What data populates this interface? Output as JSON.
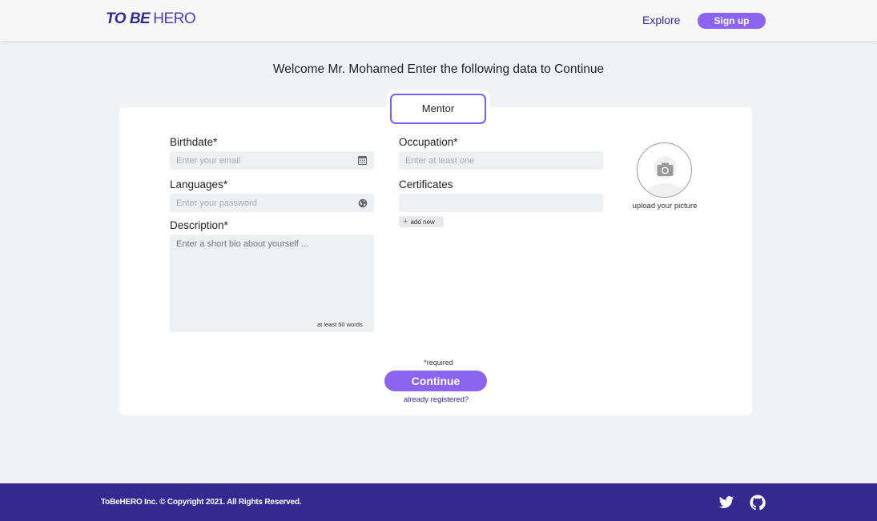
{
  "header": {
    "logo_bold": "TO BE",
    "logo_light": "HERO",
    "explore": "Explore",
    "signup": "Sign up"
  },
  "welcome": "Welcome Mr. Mohamed Enter the following data to Continue",
  "role_tab": "Mentor",
  "form": {
    "birthdate": {
      "label": "Birthdate*",
      "placeholder": "Enter your email",
      "icon": "calendar-icon"
    },
    "languages": {
      "label": "Languages*",
      "placeholder": "Enter your password",
      "icon": "globe-icon"
    },
    "description": {
      "label": "Description*",
      "placeholder": "Enter a short bio about yourself ...",
      "hint": "at least 50 words"
    },
    "occupation": {
      "label": "Occupation*",
      "placeholder": "Enter at least one"
    },
    "certificates": {
      "label": "Certificates",
      "placeholder": "",
      "add_new": "add new"
    },
    "picture": {
      "label": "upload your picture",
      "icon": "camera-icon"
    },
    "required_note": "*required",
    "continue": "Continue",
    "registered_link": "already registered?"
  },
  "footer": {
    "copyright": "ToBeHERO  Inc. © Copyright 2021. All Rights Reserved.",
    "social": [
      "twitter-icon",
      "github-icon"
    ]
  },
  "colors": {
    "brand": "#322a8f",
    "accent": "#8b65f2",
    "background": "#f1f2f6",
    "input_bg": "#eff0f4"
  }
}
